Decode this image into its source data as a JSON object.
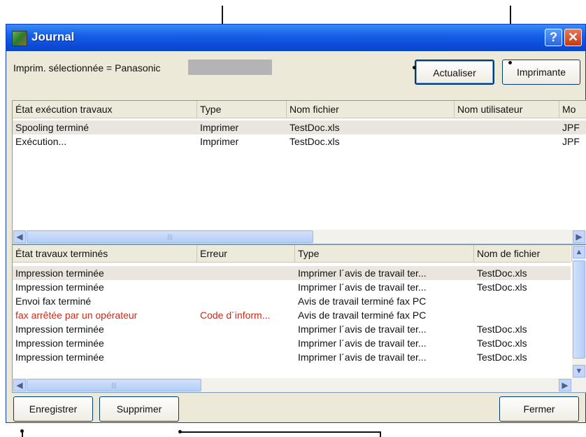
{
  "window": {
    "title": "Journal",
    "help_glyph": "?",
    "close_glyph": "✕"
  },
  "printer_label": "Imprim. sélectionnée = Panasonic",
  "buttons": {
    "refresh": "Actualiser",
    "printer": "Imprimante",
    "save": "Enregistrer",
    "delete": "Supprimer",
    "close": "Fermer"
  },
  "running_jobs": {
    "columns": [
      "État exécution travaux",
      "Type",
      "Nom fichier",
      "Nom utilisateur",
      "Mo"
    ],
    "rows": [
      [
        "Spooling terminé",
        "Imprimer",
        "TestDoc.xls",
        "",
        "JPF"
      ],
      [
        "Exécution...",
        "Imprimer",
        "TestDoc.xls",
        "",
        "JPF"
      ]
    ]
  },
  "completed_jobs": {
    "columns": [
      "État travaux terminés",
      "Erreur",
      "Type",
      "Nom de fichier"
    ],
    "rows": [
      [
        "Impression terminée",
        "",
        "Imprimer l´avis de travail ter...",
        "TestDoc.xls"
      ],
      [
        "Impression terminée",
        "",
        "Imprimer l´avis de travail ter...",
        "TestDoc.xls"
      ],
      [
        "Envoi fax terminé",
        "",
        "Avis de travail terminé fax PC",
        ""
      ],
      [
        "fax arrêtée par un opérateur",
        "Code d´inform...",
        "Avis de travail terminé fax PC",
        ""
      ],
      [
        "Impression terminée",
        "",
        "Imprimer l´avis de travail ter...",
        "TestDoc.xls"
      ],
      [
        "Impression terminée",
        "",
        "Imprimer l´avis de travail ter...",
        "TestDoc.xls"
      ],
      [
        "Impression terminée",
        "",
        "Imprimer l´avis de travail ter...",
        "TestDoc.xls"
      ]
    ]
  },
  "colors": {
    "error_text": "#cc2a1a",
    "titlebar": "#0b4bd8"
  },
  "icons": [
    "app-icon",
    "help-icon",
    "close-icon",
    "scroll-left-icon",
    "scroll-right-icon",
    "scroll-up-icon",
    "scroll-down-icon"
  ]
}
